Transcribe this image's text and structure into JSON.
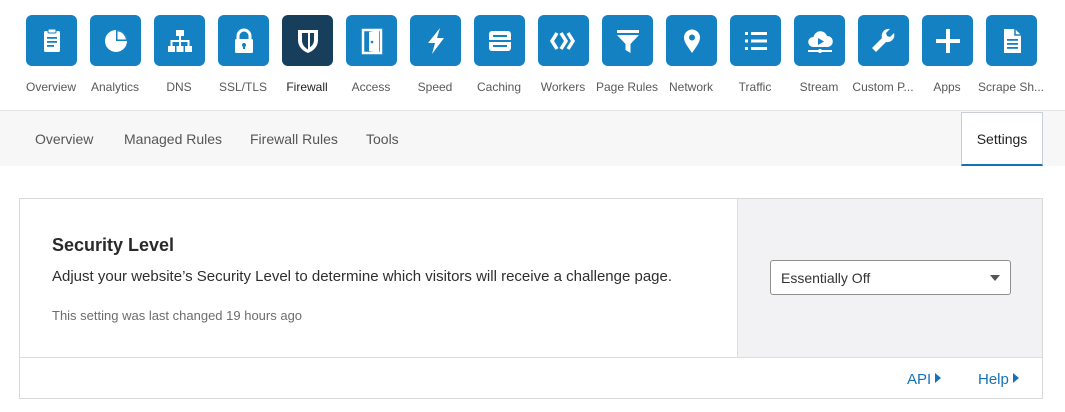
{
  "app_nav": {
    "items": [
      {
        "label": "Overview",
        "icon": "clipboard-icon",
        "active": false
      },
      {
        "label": "Analytics",
        "icon": "pie-chart-icon",
        "active": false
      },
      {
        "label": "DNS",
        "icon": "network-tree-icon",
        "active": false
      },
      {
        "label": "SSL/TLS",
        "icon": "lock-icon",
        "active": false
      },
      {
        "label": "Firewall",
        "icon": "shield-icon",
        "active": true
      },
      {
        "label": "Access",
        "icon": "door-icon",
        "active": false
      },
      {
        "label": "Speed",
        "icon": "lightning-icon",
        "active": false
      },
      {
        "label": "Caching",
        "icon": "server-drive-icon",
        "active": false
      },
      {
        "label": "Workers",
        "icon": "workers-chevrons-icon",
        "active": false
      },
      {
        "label": "Page Rules",
        "icon": "filter-funnel-icon",
        "active": false
      },
      {
        "label": "Network",
        "icon": "map-pin-icon",
        "active": false
      },
      {
        "label": "Traffic",
        "icon": "list-icon",
        "active": false
      },
      {
        "label": "Stream",
        "icon": "cloud-play-icon",
        "active": false
      },
      {
        "label": "Custom P...",
        "icon": "wrench-icon",
        "active": false
      },
      {
        "label": "Apps",
        "icon": "plus-icon",
        "active": false
      },
      {
        "label": "Scrape Sh...",
        "icon": "document-icon",
        "active": false
      }
    ],
    "tile_color": "#1381c2",
    "active_tile_color": "#173e5b"
  },
  "subnav": {
    "tabs": [
      "Overview",
      "Managed Rules",
      "Firewall Rules",
      "Tools"
    ],
    "active_tab": "Settings"
  },
  "security_level": {
    "title": "Security Level",
    "description": "Adjust your website’s Security Level to determine which visitors will receive a challenge page.",
    "note": "This setting was last changed 19 hours ago",
    "selected_value": "Essentially Off"
  },
  "footer": {
    "api_label": "API",
    "help_label": "Help"
  },
  "colors": {
    "accent": "#1672b6"
  }
}
